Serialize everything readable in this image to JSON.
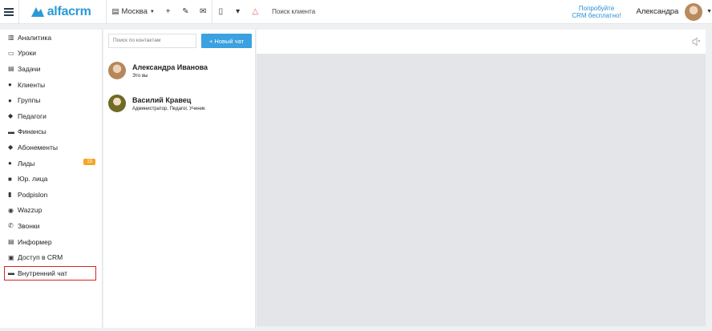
{
  "topbar": {
    "logo_text": "alfacrm",
    "branch": "Москва",
    "search_placeholder": "Поиск клиента",
    "promo_line1": "Попробуйте",
    "promo_line2": "CRM бесплатно!",
    "user_name": "Александра"
  },
  "sidebar": {
    "items": [
      {
        "label": "Аналитика",
        "icon": "chart-icon",
        "glyph": "▥"
      },
      {
        "label": "Уроки",
        "icon": "calendar-icon",
        "glyph": "▭"
      },
      {
        "label": "Задачи",
        "icon": "clipboard-icon",
        "glyph": "▤"
      },
      {
        "label": "Клиенты",
        "icon": "user-icon",
        "glyph": "●"
      },
      {
        "label": "Группы",
        "icon": "users-icon",
        "glyph": "●"
      },
      {
        "label": "Педагоги",
        "icon": "graduation-cap-icon",
        "glyph": "◆"
      },
      {
        "label": "Финансы",
        "icon": "money-icon",
        "glyph": "▬"
      },
      {
        "label": "Абонементы",
        "icon": "tag-icon",
        "glyph": "◆"
      },
      {
        "label": "Лиды",
        "icon": "user-plus-icon",
        "glyph": "●",
        "badge": "15"
      },
      {
        "label": "Юр. лица",
        "icon": "briefcase-icon",
        "glyph": "■"
      },
      {
        "label": "Podpislon",
        "icon": "document-icon",
        "glyph": "▮"
      },
      {
        "label": "Wazzup",
        "icon": "whatsapp-icon",
        "glyph": "◉"
      },
      {
        "label": "Звонки",
        "icon": "phone-icon",
        "glyph": "✆"
      },
      {
        "label": "Информер",
        "icon": "server-icon",
        "glyph": "▤"
      },
      {
        "label": "Доступ в CRM",
        "icon": "lock-icon",
        "glyph": "▣"
      },
      {
        "label": "Внутренний чат",
        "icon": "keyboard-icon",
        "glyph": "▬"
      }
    ]
  },
  "contacts": {
    "search_placeholder": "Поиск по контактам",
    "new_chat_label": "+ Новый чат",
    "list": [
      {
        "name": "Александра Иванова",
        "subtitle": "Это вы"
      },
      {
        "name": "Василий Кравец",
        "subtitle": "Администратор, Педагог, Ученик"
      }
    ]
  },
  "colors": {
    "accent": "#2a9ad6",
    "button": "#3ba1e0",
    "badge": "#f5a623",
    "highlight": "#d62424"
  }
}
